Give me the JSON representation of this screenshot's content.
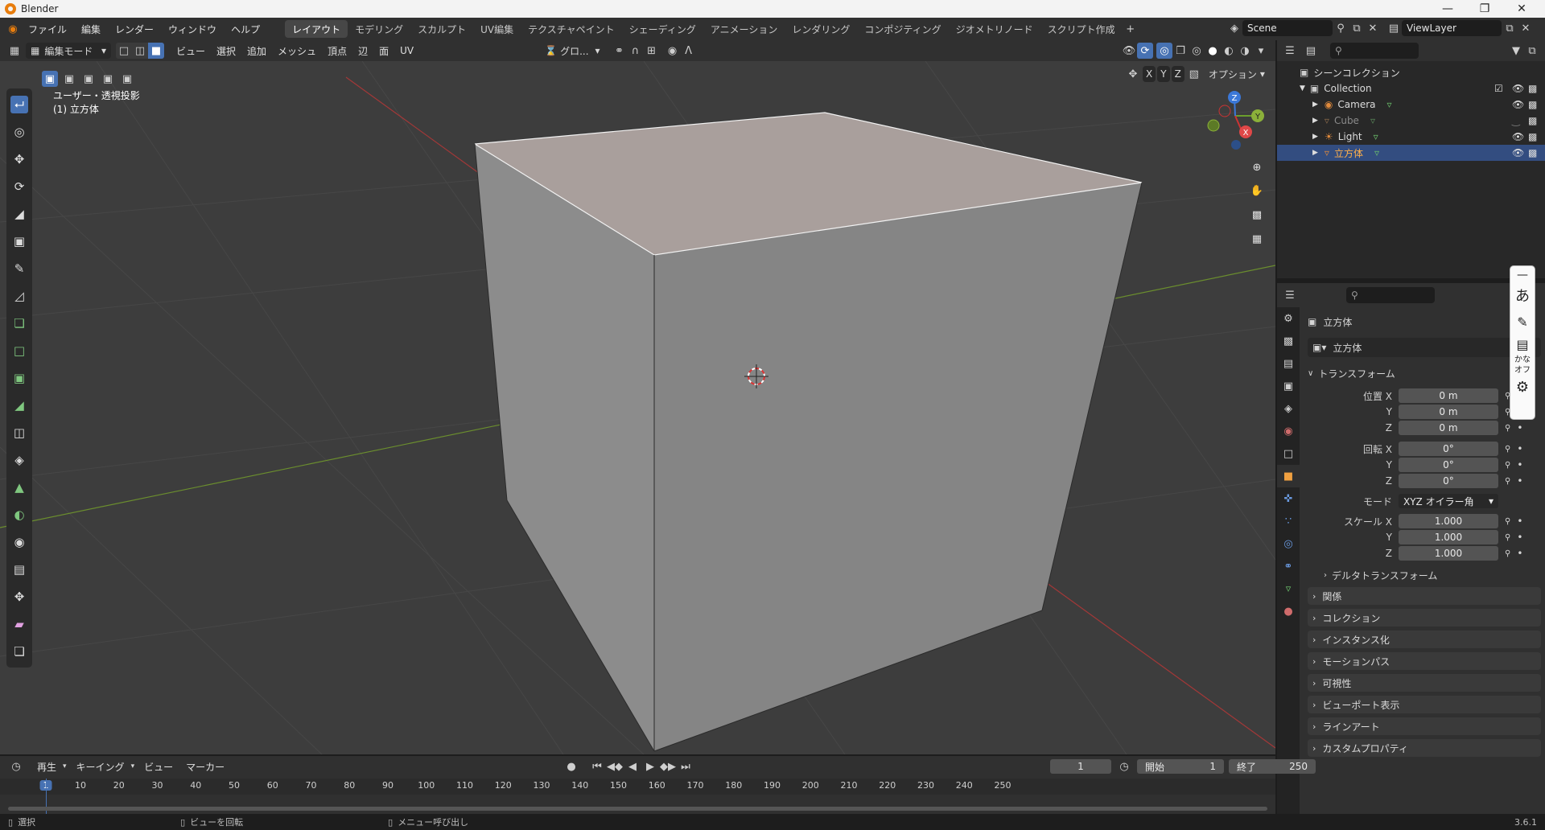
{
  "window": {
    "title": "Blender",
    "version": "3.6.1"
  },
  "menus": [
    "ファイル",
    "編集",
    "レンダー",
    "ウィンドウ",
    "ヘルプ"
  ],
  "workspaces": [
    {
      "label": "レイアウト",
      "active": true
    },
    {
      "label": "モデリング",
      "active": false
    },
    {
      "label": "スカルプト",
      "active": false
    },
    {
      "label": "UV編集",
      "active": false
    },
    {
      "label": "テクスチャペイント",
      "active": false
    },
    {
      "label": "シェーディング",
      "active": false
    },
    {
      "label": "アニメーション",
      "active": false
    },
    {
      "label": "レンダリング",
      "active": false
    },
    {
      "label": "コンポジティング",
      "active": false
    },
    {
      "label": "ジオメトリノード",
      "active": false
    },
    {
      "label": "スクリプト作成",
      "active": false
    }
  ],
  "scene": {
    "name": "Scene",
    "view_layer": "ViewLayer"
  },
  "viewport_header": {
    "mode": "編集モード",
    "menus": [
      "ビュー",
      "選択",
      "追加",
      "メッシュ",
      "頂点",
      "辺",
      "面",
      "UV"
    ],
    "transform_orientation": "グロ...",
    "options": "オプション",
    "axes": [
      "X",
      "Y",
      "Z"
    ]
  },
  "viewport": {
    "view_name": "ユーザー・透視投影",
    "object_label": "(1) 立方体"
  },
  "gizmo": {
    "x": "X",
    "y": "Y",
    "z": "Z"
  },
  "outliner": {
    "root": "シーンコレクション",
    "collection": "Collection",
    "items": [
      {
        "name": "Camera",
        "icon": "camera-icon",
        "dim": false,
        "selected": false
      },
      {
        "name": "Cube",
        "icon": "mesh-icon",
        "dim": true,
        "selected": false
      },
      {
        "name": "Light",
        "icon": "light-icon",
        "dim": false,
        "selected": false
      },
      {
        "name": "立方体",
        "icon": "mesh-icon",
        "dim": false,
        "selected": true
      }
    ]
  },
  "properties": {
    "object_title": "立方体",
    "object_name": "立方体",
    "transform_header": "トランスフォーム",
    "location_label": "位置 X",
    "rotation_label": "回転 X",
    "scale_label": "スケール X",
    "y_label": "Y",
    "z_label": "Z",
    "location": [
      "0 m",
      "0 m",
      "0 m"
    ],
    "rotation": [
      "0°",
      "0°",
      "0°"
    ],
    "mode_label": "モード",
    "mode_value": "XYZ オイラー角",
    "scale": [
      "1.000",
      "1.000",
      "1.000"
    ],
    "delta": "デルタトランスフォーム",
    "panels": [
      "関係",
      "コレクション",
      "インスタンス化",
      "モーションパス",
      "可視性",
      "ビューポート表示",
      "ラインアート",
      "カスタムプロパティ"
    ]
  },
  "timeline": {
    "menus": [
      "再生",
      "キーイング",
      "ビュー",
      "マーカー"
    ],
    "current_frame": "1",
    "start_label": "開始",
    "start": "1",
    "end_label": "終了",
    "end": "250",
    "ruler": [
      "1",
      "10",
      "20",
      "30",
      "40",
      "50",
      "60",
      "70",
      "80",
      "90",
      "100",
      "110",
      "120",
      "130",
      "140",
      "150",
      "160",
      "170",
      "180",
      "190",
      "200",
      "210",
      "220",
      "230",
      "240",
      "250"
    ]
  },
  "statusbar": {
    "select": "選択",
    "rotate": "ビューを回転",
    "menu": "メニュー呼び出し"
  },
  "ime": {
    "hiragana": "あ",
    "kana_line1": "かな",
    "kana_line2": "オフ"
  },
  "colors": {
    "accent": "#4772b3",
    "selected_row": "#334d80",
    "viewport_bg": "#3d3d3d"
  }
}
